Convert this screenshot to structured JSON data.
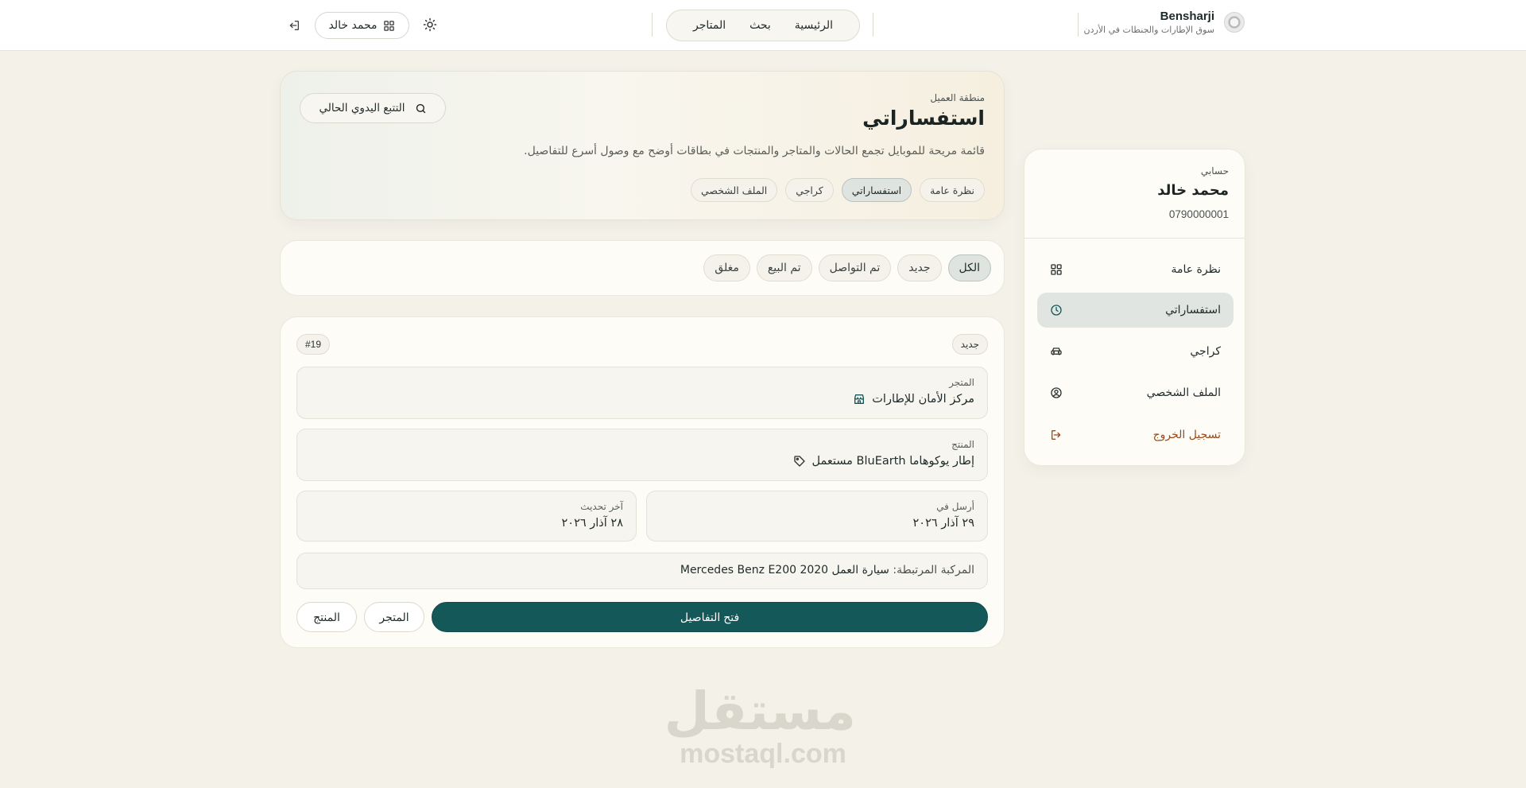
{
  "header": {
    "brand_name": "Bensharji",
    "brand_tagline": "سوق الإطارات والجنطات في الأردن",
    "nav": [
      "الرئيسية",
      "بحث",
      "المتاجر"
    ],
    "user_chip_label": "محمد خالد"
  },
  "hero": {
    "kicker": "منطقة العميل",
    "title": "استفساراتي",
    "description": "قائمة مريحة للموبايل تجمع الحالات والمتاجر والمنتجات في بطاقات أوضح مع وصول أسرع للتفاصيل.",
    "tabs": [
      "نظرة عامة",
      "استفساراتي",
      "كراجي",
      "الملف الشخصي"
    ],
    "active_tab": "استفساراتي",
    "track_button": "التتبع اليدوي الحالي"
  },
  "filters": {
    "items": [
      "الكل",
      "جديد",
      "تم التواصل",
      "تم البيع",
      "مغلق"
    ],
    "active": "الكل"
  },
  "inquiry": {
    "status": "جديد",
    "id": "#19",
    "store_label": "المتجر",
    "store_value": "مركز الأمان للإطارات",
    "product_label": "المنتج",
    "product_value": "إطار يوكوهاما BluEarth مستعمل",
    "sent_label": "أرسل في",
    "sent_value": "٢٩ آذار ٢٠٢٦",
    "updated_label": "آخر تحديث",
    "updated_value": "٢٨ آذار ٢٠٢٦",
    "vehicle_label": "المركبة المرتبطة:",
    "vehicle_value": "سيارة العمل Mercedes Benz E200 2020",
    "open_details": "فتح التفاصيل",
    "store_button": "المتجر",
    "product_button": "المنتج"
  },
  "sidebar": {
    "kicker": "حسابي",
    "name": "محمد خالد",
    "phone": "0790000001",
    "items": [
      {
        "label": "نظرة عامة",
        "icon": "grid-icon"
      },
      {
        "label": "استفساراتي",
        "icon": "clock-icon"
      },
      {
        "label": "كراجي",
        "icon": "car-icon"
      },
      {
        "label": "الملف الشخصي",
        "icon": "user-circle-icon"
      },
      {
        "label": "تسجيل الخروج",
        "icon": "logout-icon"
      }
    ],
    "active": "استفساراتي"
  },
  "watermark": {
    "arabic": "مستقل",
    "latin": "mostaql.com"
  },
  "colors": {
    "primary": "#15585a",
    "background": "#f3f1e8",
    "logout": "#9b4a1c"
  }
}
